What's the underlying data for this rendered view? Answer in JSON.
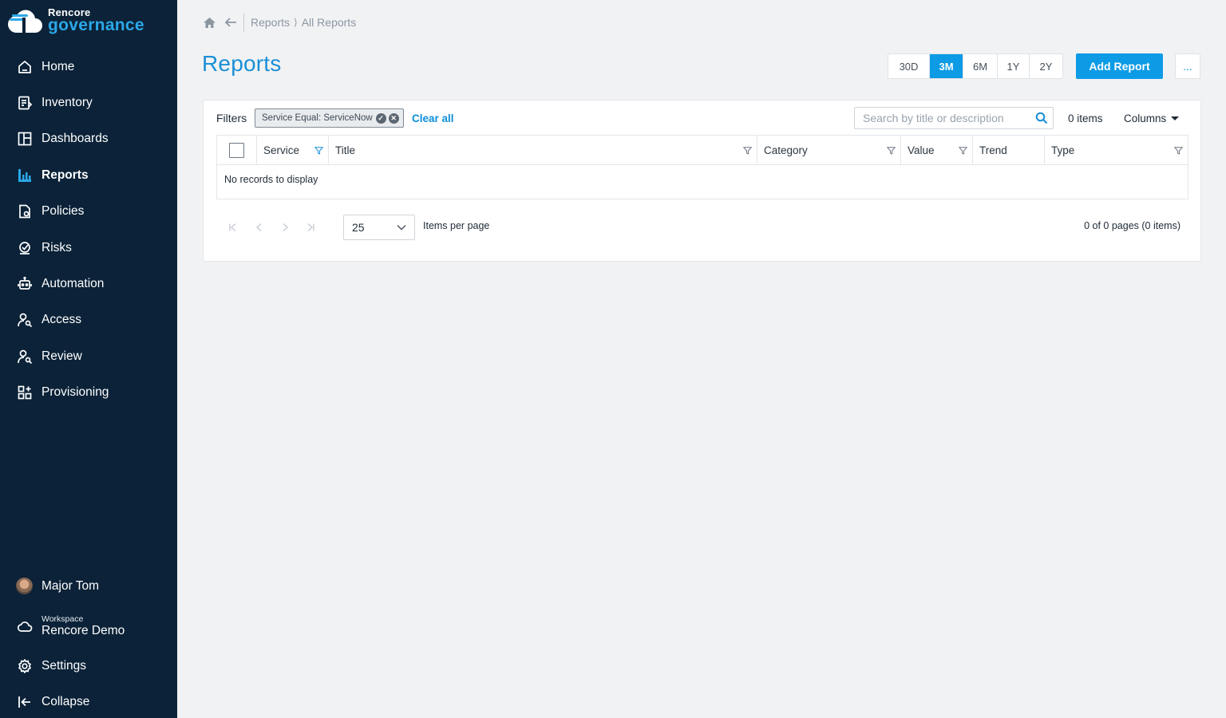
{
  "brand": {
    "top": "Rencore",
    "bottom": "governance"
  },
  "sidebar": {
    "items": [
      {
        "label": "Home",
        "icon": "home-icon"
      },
      {
        "label": "Inventory",
        "icon": "inventory-icon"
      },
      {
        "label": "Dashboards",
        "icon": "dashboards-icon"
      },
      {
        "label": "Reports",
        "icon": "reports-icon",
        "active": true
      },
      {
        "label": "Policies",
        "icon": "policies-icon"
      },
      {
        "label": "Risks",
        "icon": "risks-icon"
      },
      {
        "label": "Automation",
        "icon": "robot-icon"
      },
      {
        "label": "Access",
        "icon": "user-search-icon"
      },
      {
        "label": "Review",
        "icon": "user-search-icon"
      },
      {
        "label": "Provisioning",
        "icon": "provisioning-icon"
      }
    ],
    "user": {
      "name": "Major Tom"
    },
    "workspace": {
      "label": "Workspace",
      "name": "Rencore Demo"
    },
    "settings": "Settings",
    "collapse": "Collapse"
  },
  "breadcrumb": {
    "items": [
      "Reports",
      "All Reports"
    ],
    "separator": "⟩"
  },
  "page": {
    "title": "Reports"
  },
  "periods": [
    {
      "label": "30D",
      "active": false
    },
    {
      "label": "3M",
      "active": true
    },
    {
      "label": "6M",
      "active": false
    },
    {
      "label": "1Y",
      "active": false
    },
    {
      "label": "2Y",
      "active": false
    }
  ],
  "actions": {
    "add_report": "Add Report",
    "more": "..."
  },
  "filters": {
    "label": "Filters",
    "chips": [
      {
        "text": "Service Equal: ServiceNow"
      }
    ],
    "clear_all": "Clear all"
  },
  "search": {
    "placeholder": "Search by title or description",
    "value": ""
  },
  "items_count": "0 items",
  "columns_label": "Columns",
  "grid": {
    "columns": [
      "Service",
      "Title",
      "Category",
      "Value",
      "Trend",
      "Type"
    ],
    "empty_message": "No records to display"
  },
  "pager": {
    "page_size": "25",
    "items_per_page_label": "Items per page",
    "info": "0 of 0 pages (0 items)"
  },
  "colors": {
    "sidebar_bg": "#0b2238",
    "accent": "#0d9be6",
    "title": "#1a8fd6",
    "page_bg": "#f1f2f4"
  }
}
